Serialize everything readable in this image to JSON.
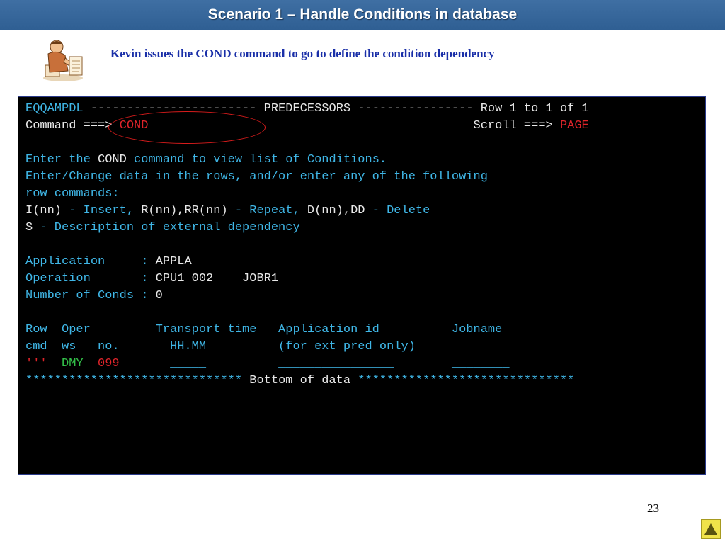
{
  "slide": {
    "title": "Scenario 1 – Handle Conditions in database",
    "subtitle": "Kevin issues the COND command to go to define the condition dependency",
    "page_number": "23"
  },
  "terminal": {
    "line1_panel": "EQQAMPDL",
    "line1_dashes_a": " ----------------------- ",
    "line1_heading": "PREDECESSORS",
    "line1_dashes_b": " ---------------- ",
    "line1_rows": "Row 1 to 1 of 1",
    "cmd_label": "Command ===> ",
    "cmd_value": "COND",
    "cmd_gap": "                                             ",
    "scroll_label": "Scroll ===> ",
    "scroll_value": "PAGE",
    "help1_a": "Enter the ",
    "help1_cmd": "COND",
    "help1_b": " command to view list of Conditions.",
    "help2": "Enter/Change data in the rows, and/or enter any of the following",
    "help3": "row commands:",
    "rc1_a": "I(nn)",
    "rc1_b": " - Insert, ",
    "rc1_c": "R(nn),RR(nn)",
    "rc1_d": " - Repeat, ",
    "rc1_e": "D(nn),DD",
    "rc1_f": " - Delete",
    "rc2_a": "S",
    "rc2_b": " - Description of external dependency",
    "app_label": "Application     : ",
    "app_value": "APPLA",
    "op_label": "Operation       : ",
    "op_value": "CPU1 002    JOBR1",
    "nconds_label": "Number of Conds : ",
    "nconds_value": "0",
    "hdr1": "Row  Oper         Transport time   Application id          Jobname",
    "hdr2": "cmd  ws   no.       HH.MM          (for ext pred only)",
    "row_cmd": "'''",
    "row_ws": "DMY",
    "row_no": "099",
    "row_time_field": "_____",
    "row_appid_field": "________________",
    "row_job_field": "________",
    "bottom_stars_a": "******************************",
    "bottom_text": " Bottom of data ",
    "bottom_stars_b": "******************************"
  },
  "colors": {
    "title_bar": "#2f5f93",
    "subtitle": "#1a2fa8",
    "terminal_bg": "#000000",
    "highlight_ellipse": "#d81c1c",
    "nav_button": "#f0e34a"
  }
}
